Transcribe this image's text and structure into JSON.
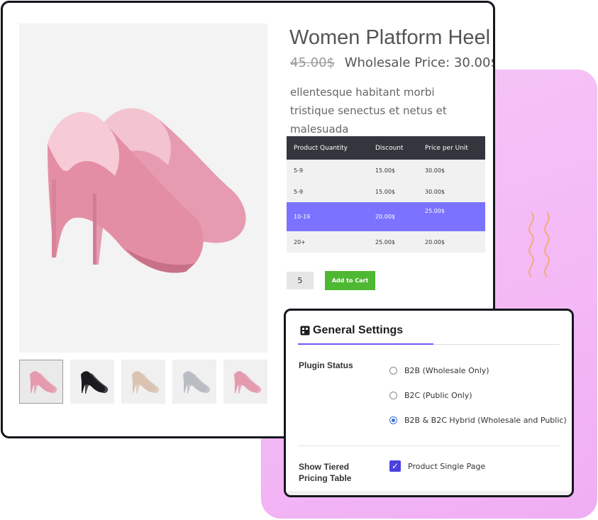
{
  "product": {
    "title": "Women Platform Heel",
    "old_price": "45.00$",
    "wholesale_price": "Wholesale Price: 30.00$",
    "description": "ellentesque habitant morbi tristique senectus et netus et malesuada",
    "image_icon": "pink-high-heel-shoe"
  },
  "thumbnails": [
    {
      "icon": "pink-heel",
      "color": "#e59aae",
      "active": true
    },
    {
      "icon": "black-heel",
      "color": "#1b1b1f",
      "active": false
    },
    {
      "icon": "nude-heel",
      "color": "#d9c3b3",
      "active": false
    },
    {
      "icon": "silver-heel",
      "color": "#b9bcc2",
      "active": false
    },
    {
      "icon": "pink-heel",
      "color": "#e59aae",
      "active": false
    }
  ],
  "tier_table": {
    "headers": [
      "Product Quantity",
      "Discount",
      "Price per Unit"
    ],
    "rows": [
      [
        "5-9",
        "15.00$",
        "30.00$"
      ],
      [
        "5-9",
        "15.00$",
        "30.00$"
      ],
      [
        "10-19",
        "20.00$",
        "25.00$"
      ],
      [
        "20+",
        "25.00$",
        "20.00$"
      ]
    ],
    "highlight_color": "#7b73ff"
  },
  "cart": {
    "quantity": "5",
    "add_label": "Add to Cart",
    "button_color": "#4fb833"
  },
  "settings": {
    "title": "General Settings",
    "plugin_status_label": "Plugin Status",
    "options": [
      {
        "label": "B2B (Wholesale Only)",
        "selected": false
      },
      {
        "label": "B2C (Public Only)",
        "selected": false
      },
      {
        "label": "B2B & B2C Hybrid (Wholesale and Public)",
        "selected": true
      }
    ],
    "tiered_label": "Show Tiered Pricing Table",
    "checkbox_label": "Product Single Page",
    "checkbox_checked": true,
    "accent_color": "#6a5cf2"
  },
  "decor": {
    "background_color": "#f3b8f5",
    "squiggle_color": "#f2ab78"
  }
}
